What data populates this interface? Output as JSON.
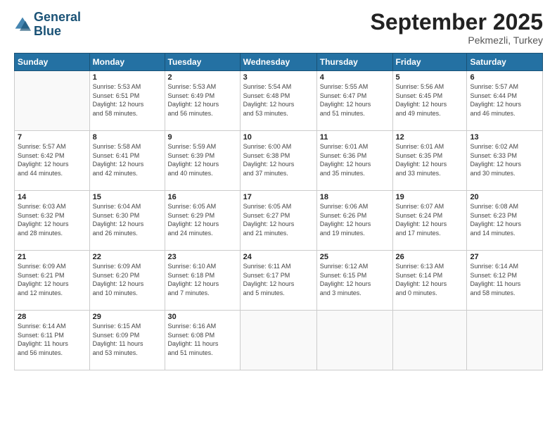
{
  "logo": {
    "line1": "General",
    "line2": "Blue"
  },
  "title": "September 2025",
  "location": "Pekmezli, Turkey",
  "days_header": [
    "Sunday",
    "Monday",
    "Tuesday",
    "Wednesday",
    "Thursday",
    "Friday",
    "Saturday"
  ],
  "weeks": [
    [
      {
        "day": "",
        "info": ""
      },
      {
        "day": "1",
        "info": "Sunrise: 5:53 AM\nSunset: 6:51 PM\nDaylight: 12 hours\nand 58 minutes."
      },
      {
        "day": "2",
        "info": "Sunrise: 5:53 AM\nSunset: 6:49 PM\nDaylight: 12 hours\nand 56 minutes."
      },
      {
        "day": "3",
        "info": "Sunrise: 5:54 AM\nSunset: 6:48 PM\nDaylight: 12 hours\nand 53 minutes."
      },
      {
        "day": "4",
        "info": "Sunrise: 5:55 AM\nSunset: 6:47 PM\nDaylight: 12 hours\nand 51 minutes."
      },
      {
        "day": "5",
        "info": "Sunrise: 5:56 AM\nSunset: 6:45 PM\nDaylight: 12 hours\nand 49 minutes."
      },
      {
        "day": "6",
        "info": "Sunrise: 5:57 AM\nSunset: 6:44 PM\nDaylight: 12 hours\nand 46 minutes."
      }
    ],
    [
      {
        "day": "7",
        "info": "Sunrise: 5:57 AM\nSunset: 6:42 PM\nDaylight: 12 hours\nand 44 minutes."
      },
      {
        "day": "8",
        "info": "Sunrise: 5:58 AM\nSunset: 6:41 PM\nDaylight: 12 hours\nand 42 minutes."
      },
      {
        "day": "9",
        "info": "Sunrise: 5:59 AM\nSunset: 6:39 PM\nDaylight: 12 hours\nand 40 minutes."
      },
      {
        "day": "10",
        "info": "Sunrise: 6:00 AM\nSunset: 6:38 PM\nDaylight: 12 hours\nand 37 minutes."
      },
      {
        "day": "11",
        "info": "Sunrise: 6:01 AM\nSunset: 6:36 PM\nDaylight: 12 hours\nand 35 minutes."
      },
      {
        "day": "12",
        "info": "Sunrise: 6:01 AM\nSunset: 6:35 PM\nDaylight: 12 hours\nand 33 minutes."
      },
      {
        "day": "13",
        "info": "Sunrise: 6:02 AM\nSunset: 6:33 PM\nDaylight: 12 hours\nand 30 minutes."
      }
    ],
    [
      {
        "day": "14",
        "info": "Sunrise: 6:03 AM\nSunset: 6:32 PM\nDaylight: 12 hours\nand 28 minutes."
      },
      {
        "day": "15",
        "info": "Sunrise: 6:04 AM\nSunset: 6:30 PM\nDaylight: 12 hours\nand 26 minutes."
      },
      {
        "day": "16",
        "info": "Sunrise: 6:05 AM\nSunset: 6:29 PM\nDaylight: 12 hours\nand 24 minutes."
      },
      {
        "day": "17",
        "info": "Sunrise: 6:05 AM\nSunset: 6:27 PM\nDaylight: 12 hours\nand 21 minutes."
      },
      {
        "day": "18",
        "info": "Sunrise: 6:06 AM\nSunset: 6:26 PM\nDaylight: 12 hours\nand 19 minutes."
      },
      {
        "day": "19",
        "info": "Sunrise: 6:07 AM\nSunset: 6:24 PM\nDaylight: 12 hours\nand 17 minutes."
      },
      {
        "day": "20",
        "info": "Sunrise: 6:08 AM\nSunset: 6:23 PM\nDaylight: 12 hours\nand 14 minutes."
      }
    ],
    [
      {
        "day": "21",
        "info": "Sunrise: 6:09 AM\nSunset: 6:21 PM\nDaylight: 12 hours\nand 12 minutes."
      },
      {
        "day": "22",
        "info": "Sunrise: 6:09 AM\nSunset: 6:20 PM\nDaylight: 12 hours\nand 10 minutes."
      },
      {
        "day": "23",
        "info": "Sunrise: 6:10 AM\nSunset: 6:18 PM\nDaylight: 12 hours\nand 7 minutes."
      },
      {
        "day": "24",
        "info": "Sunrise: 6:11 AM\nSunset: 6:17 PM\nDaylight: 12 hours\nand 5 minutes."
      },
      {
        "day": "25",
        "info": "Sunrise: 6:12 AM\nSunset: 6:15 PM\nDaylight: 12 hours\nand 3 minutes."
      },
      {
        "day": "26",
        "info": "Sunrise: 6:13 AM\nSunset: 6:14 PM\nDaylight: 12 hours\nand 0 minutes."
      },
      {
        "day": "27",
        "info": "Sunrise: 6:14 AM\nSunset: 6:12 PM\nDaylight: 11 hours\nand 58 minutes."
      }
    ],
    [
      {
        "day": "28",
        "info": "Sunrise: 6:14 AM\nSunset: 6:11 PM\nDaylight: 11 hours\nand 56 minutes."
      },
      {
        "day": "29",
        "info": "Sunrise: 6:15 AM\nSunset: 6:09 PM\nDaylight: 11 hours\nand 53 minutes."
      },
      {
        "day": "30",
        "info": "Sunrise: 6:16 AM\nSunset: 6:08 PM\nDaylight: 11 hours\nand 51 minutes."
      },
      {
        "day": "",
        "info": ""
      },
      {
        "day": "",
        "info": ""
      },
      {
        "day": "",
        "info": ""
      },
      {
        "day": "",
        "info": ""
      }
    ]
  ]
}
